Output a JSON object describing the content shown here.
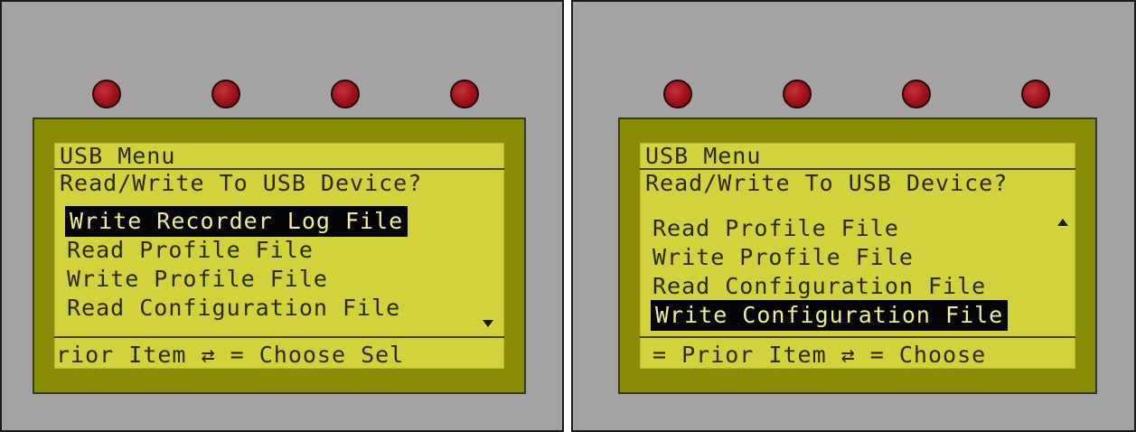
{
  "left_screen": {
    "title": "USB Menu",
    "prompt": "Read/Write To USB Device?",
    "items": [
      "Write Recorder Log File",
      "Read Profile File",
      "Write Profile File",
      "Read Configuration File"
    ],
    "selected_index": 0,
    "footer": "rior Item   ⇄ = Choose Sel",
    "scroll_indicator": "down-arrow-icon"
  },
  "right_screen": {
    "title": "USB Menu",
    "prompt": "Read/Write To USB Device?",
    "items": [
      "Read Profile File",
      "Write Profile File",
      "Read Configuration File",
      "Write Configuration File"
    ],
    "selected_index": 3,
    "footer": "= Prior Item    ⇄ = Choose",
    "scroll_indicator": "up-arrow-icon"
  },
  "colors": {
    "panel": "#a3a3a3",
    "screen_bezel": "#898c07",
    "lcd": "#d1d23c",
    "led": "#9a1218",
    "selection": "#050505"
  }
}
